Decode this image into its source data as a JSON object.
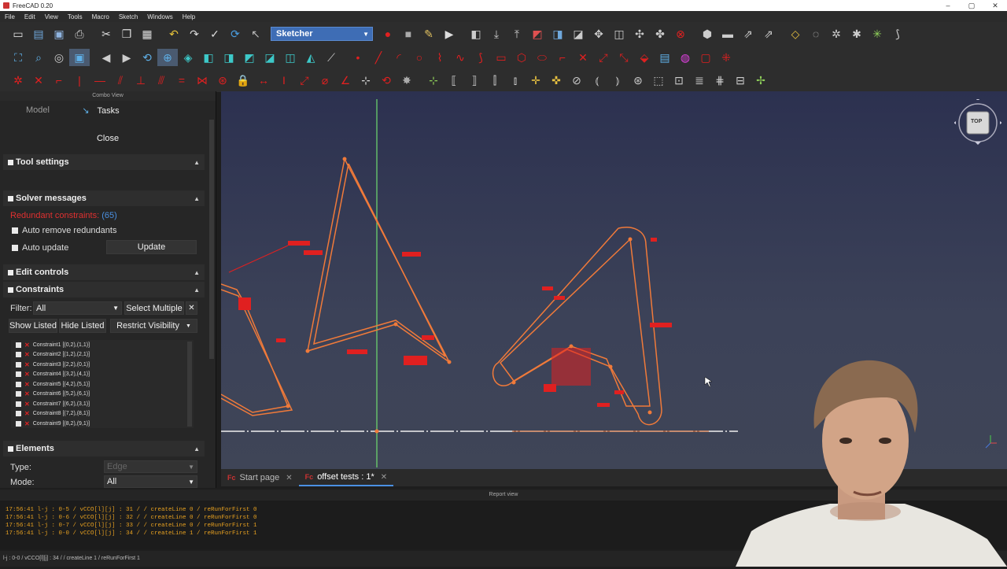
{
  "window": {
    "title": "FreeCAD 0.20"
  },
  "menu": [
    "File",
    "Edit",
    "View",
    "Tools",
    "Macro",
    "Sketch",
    "Windows",
    "Help"
  ],
  "workbench": {
    "selected": "Sketcher"
  },
  "combo_view": {
    "title": "Combo View",
    "tabs": [
      "Model",
      "Tasks"
    ],
    "close_label": "Close",
    "sections": {
      "tool_settings": "Tool settings",
      "solver_messages": "Solver messages",
      "edit_controls": "Edit controls",
      "constraints": "Constraints",
      "elements": "Elements"
    },
    "solver": {
      "redundant_label": "Redundant constraints:",
      "redundant_count": "(65)",
      "auto_remove": "Auto remove redundants",
      "auto_update": "Auto update",
      "update_label": "Update"
    },
    "constraints": {
      "filter_label": "Filter:",
      "filter_value": "All",
      "select_multiple": "Select Multiple",
      "show_listed": "Show Listed",
      "hide_listed": "Hide Listed",
      "restrict_visibility": "Restrict Visibility",
      "items": [
        "Constraint1 [(0,2),(1,1)]",
        "Constraint2 [(1,2),(2,1)]",
        "Constraint3 [(2,2),(0,1)]",
        "Constraint4 [(3,2),(4,1)]",
        "Constraint5 [(4,2),(5,1)]",
        "Constraint6 [(5,2),(6,1)]",
        "Constraint7 [(6,2),(3,1)]",
        "Constraint8 [(7,2),(8,1)]",
        "Constraint9 [(8,2),(9,1)]"
      ]
    },
    "elements": {
      "type_label": "Type:",
      "type_value": "Edge",
      "mode_label": "Mode:",
      "mode_value": "All"
    }
  },
  "navcube": {
    "face": "TOP"
  },
  "doc_tabs": [
    {
      "label": "Start page",
      "active": false
    },
    {
      "label": "offset tests : 1*",
      "active": true
    }
  ],
  "report": {
    "title": "Report view",
    "lines": [
      "17:56:41  l-j : 0-5 / vCCO[l][j] : 31 / / createLine 0 / reRunForFirst 0",
      "17:56:41  l-j : 0-6 / vCCO[l][j] : 32 / / createLine 0 / reRunForFirst 0",
      "17:56:41  l-j : 0-7 / vCCO[l][j] : 33 / / createLine 0 / reRunForFirst 1",
      "17:56:41  l-j : 0-0 / vCCO[l][j] : 34 / / createLine 1 / reRunForFirst 1"
    ]
  },
  "status": "l-j : 0-0 / vCCO[l][j] : 34 / / createLine 1 / reRunForFirst 1",
  "colors": {
    "sketch": "#f07a3a",
    "constraint": "#e02020",
    "accent": "#3e6db5"
  }
}
